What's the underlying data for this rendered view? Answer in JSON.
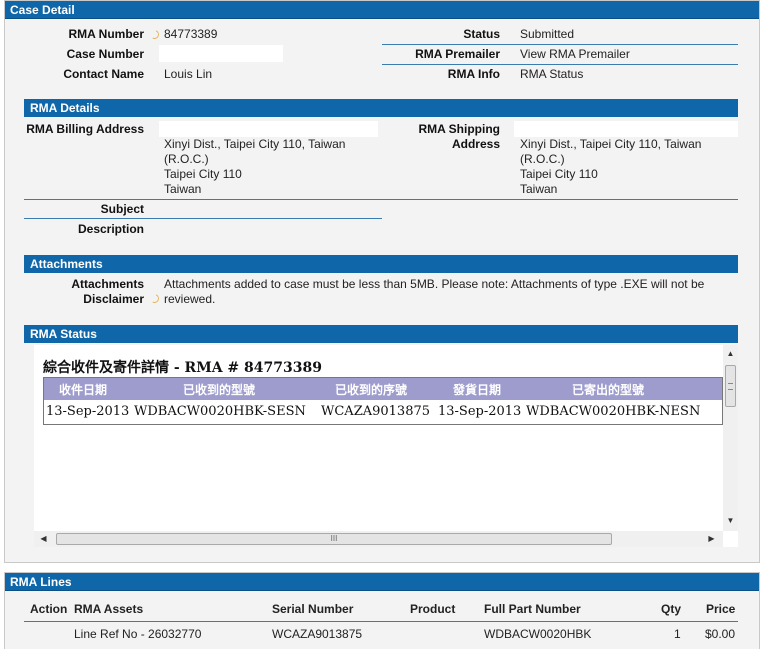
{
  "case_detail": {
    "title": "Case Detail",
    "rma_number_label": "RMA Number",
    "rma_number": "84773389",
    "status_label": "Status",
    "status": "Submitted",
    "case_number_label": "Case Number",
    "case_number": "",
    "rma_premailer_label": "RMA Premailer",
    "rma_premailer_link": "View RMA Premailer",
    "contact_name_label": "Contact Name",
    "contact_name": "Louis Lin",
    "rma_info_label": "RMA Info",
    "rma_info_link": "RMA Status"
  },
  "rma_details": {
    "title": "RMA Details",
    "billing_label": "RMA Billing Address",
    "billing_lines": [
      "Xinyi Dist., Taipei City 110, Taiwan",
      "(R.O.C.)",
      "Taipei City 110",
      "Taiwan"
    ],
    "shipping_label_1": "RMA Shipping",
    "shipping_label_2": "Address",
    "shipping_lines": [
      "Xinyi Dist., Taipei City 110, Taiwan",
      "(R.O.C.)",
      "Taipei City 110",
      "Taiwan"
    ],
    "subject_label": "Subject",
    "description_label": "Description"
  },
  "attachments": {
    "title": "Attachments",
    "disclaimer_label_1": "Attachments",
    "disclaimer_label_2": "Disclaimer",
    "disclaimer_line_1": "Attachments added to case must be less than 5MB. Please note: Attachments of type .EXE will not be",
    "disclaimer_line_2": "reviewed."
  },
  "rma_status": {
    "title": "RMA Status",
    "frame_title": "綜合收件及寄件詳情 - RMA # 84773389",
    "columns": [
      "收件日期",
      "已收到的型號",
      "已收到的序號",
      "發貨日期",
      "已寄出的型號"
    ],
    "row": [
      "13-Sep-2013",
      "WDBACW0020HBK-SESN",
      "WCAZA9013875",
      "13-Sep-2013",
      "WDBACW0020HBK-NESN"
    ],
    "hscroll_grip": "III"
  },
  "rma_lines": {
    "title": "RMA Lines",
    "columns": {
      "action": "Action",
      "assets": "RMA Assets",
      "serial": "Serial Number",
      "product": "Product",
      "part": "Full Part Number",
      "qty": "Qty",
      "price": "Price"
    },
    "rows": [
      {
        "assets": "Line Ref No - 26032770",
        "serial": "WCAZA9013875",
        "product": "",
        "part": "WDBACW0020HBK",
        "qty": "1",
        "price": "$0.00"
      }
    ]
  },
  "colors": {
    "header_blue": "#0f67a9",
    "table_head_purple": "#9d9ccd",
    "panel_bg": "#f3f3f3"
  },
  "icons": {
    "help": "help-icon"
  }
}
